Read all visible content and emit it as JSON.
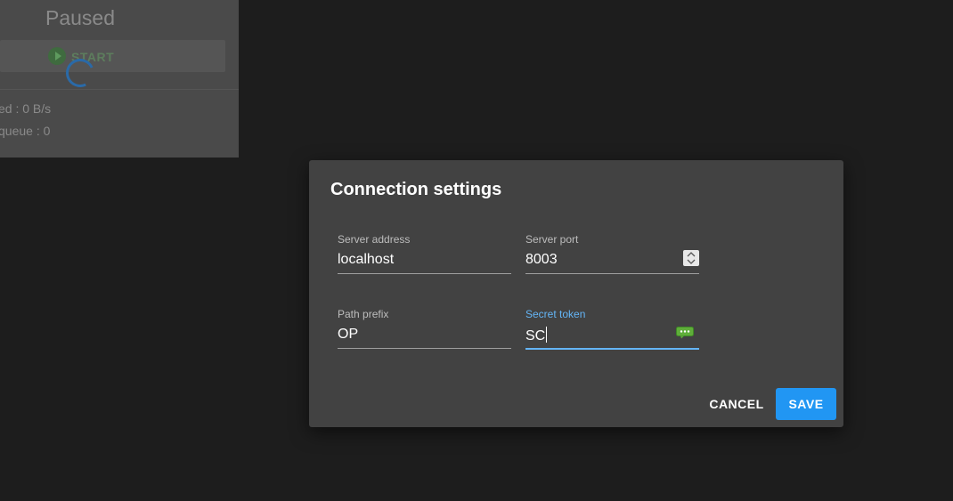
{
  "background": {
    "status_title": "Paused",
    "start_label": "START",
    "stats": [
      "ed : 0 B/s",
      "queue : 0"
    ]
  },
  "dialog": {
    "title": "Connection settings",
    "fields": {
      "server_address": {
        "label": "Server address",
        "value": "localhost"
      },
      "server_port": {
        "label": "Server port",
        "value": "8003"
      },
      "path_prefix": {
        "label": "Path prefix",
        "value": "OP"
      },
      "secret_token": {
        "label": "Secret token",
        "value": "SC"
      }
    },
    "actions": {
      "cancel_label": "CANCEL",
      "save_label": "SAVE"
    }
  },
  "colors": {
    "accent": "#2196f3",
    "focus": "#64b5f6",
    "dialog_bg": "#424242",
    "page_bg": "#1d1d1d"
  },
  "icons": {
    "spinner": "loading-spinner-icon",
    "start": "play-icon",
    "port_stepper": "stepper-arrows-icon",
    "password_manager": "password-manager-icon"
  }
}
